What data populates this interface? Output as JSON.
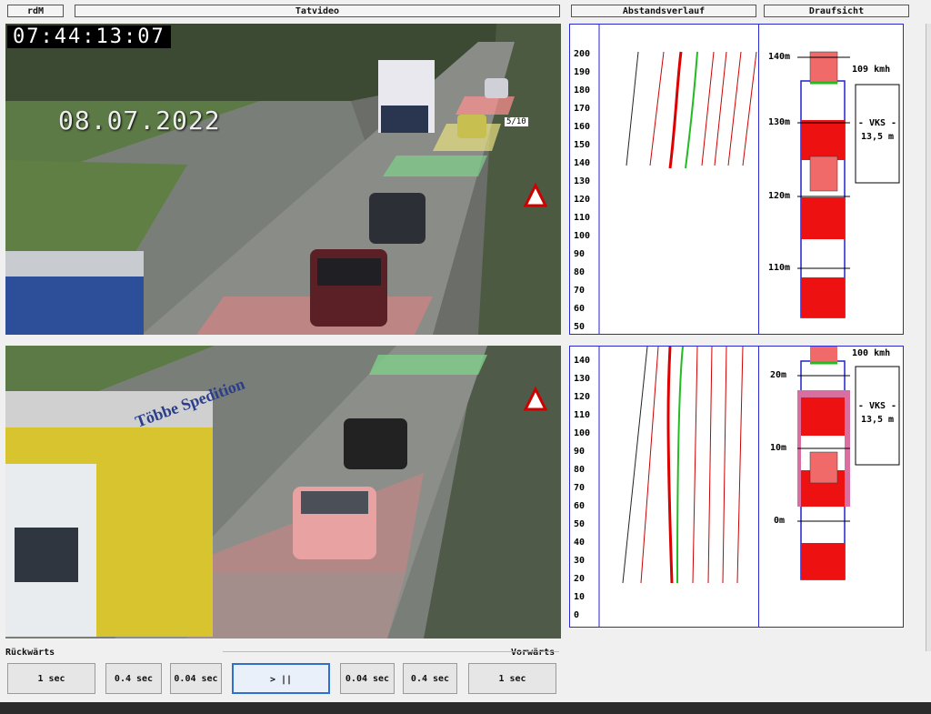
{
  "headers": {
    "left": "rdM",
    "center": "Tatvideo",
    "distance": "Abstandsverlauf",
    "top_view": "Draufsicht"
  },
  "top_video": {
    "timestamp": "07:44:13:07",
    "date": "08.07.2022",
    "counter": "5/10"
  },
  "top_axis": {
    "ticks": [
      "200",
      "190",
      "180",
      "170",
      "160",
      "150",
      "140",
      "130",
      "120",
      "110",
      "100",
      "90",
      "80",
      "70",
      "60",
      "50"
    ]
  },
  "bottom_axis": {
    "ticks": [
      "140",
      "130",
      "120",
      "110",
      "100",
      "90",
      "80",
      "70",
      "60",
      "50",
      "40",
      "30",
      "20",
      "10",
      "0"
    ]
  },
  "top_view_upper": {
    "speed": "109 kmh",
    "vks_label": "- VKS -",
    "vks_value": "13,5 m",
    "markers": [
      "140m",
      "130m",
      "120m",
      "110m"
    ]
  },
  "top_view_lower": {
    "speed": "100 kmh",
    "vks_label": "- VKS -",
    "vks_value": "13,5 m",
    "markers": [
      "20m",
      "10m",
      "0m"
    ]
  },
  "controls": {
    "backward_label": "Rückwärts",
    "forward_label": "Vorwärts",
    "buttons": [
      "1 sec",
      "0.4 sec",
      "0.04 sec",
      "> ||",
      "0.04 sec",
      "0.4 sec",
      "1 sec"
    ]
  },
  "truck_text": "Többe Spedition",
  "colors": {
    "accent_blue": "#2222cc",
    "red_mark": "#ff0000",
    "green_mark": "#22bb22"
  }
}
